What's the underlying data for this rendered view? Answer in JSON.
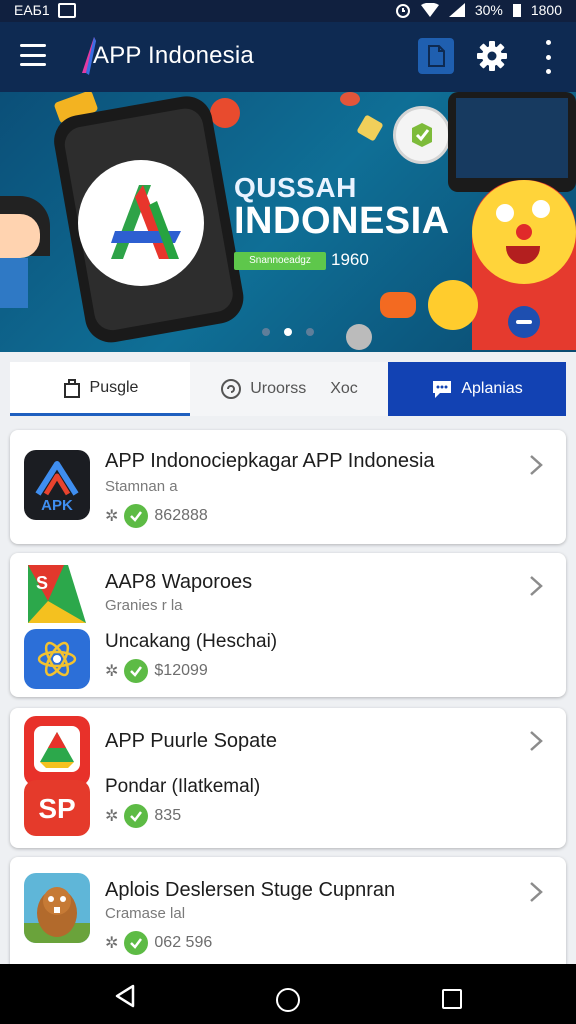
{
  "status_bar": {
    "left_text": "EAБ1",
    "battery": "30%",
    "time": "1800"
  },
  "app_bar": {
    "title": "APP Indonesia"
  },
  "banner": {
    "headline_1": "QUSSAH",
    "headline_2": "INDONESIA",
    "chip": "Snannoeadgz",
    "year": "1960",
    "active_page": 2,
    "page_count": 3
  },
  "tabs": [
    {
      "label": "Pusgle"
    },
    {
      "label": "Uroorss",
      "extra": "Xoc"
    },
    {
      "label": "Aplanias"
    }
  ],
  "cards": [
    {
      "title": "APP Indonociepkagar APP Indonesia",
      "subtitle": "Stamnan a",
      "meta_value": "862888",
      "icon_text": "APK"
    },
    {
      "title": "AAP8 Waporoes",
      "subtitle": "Granies r la",
      "title_2": "Uncakang (Heschai)",
      "meta_value": "$12099",
      "icon_text": "S"
    },
    {
      "title": "APP Puurle Sopate",
      "title_2": "Pondar (Ilatkemal)",
      "meta_value": "835",
      "icon_text": "SP"
    },
    {
      "title": "Aplois Deslersen Stuge Cupnran",
      "subtitle": "Cramase lal",
      "meta_value": "062 596"
    }
  ],
  "colors": {
    "app_bar": "#0e2a52",
    "accent": "#1242b3",
    "check": "#5dbb45"
  }
}
